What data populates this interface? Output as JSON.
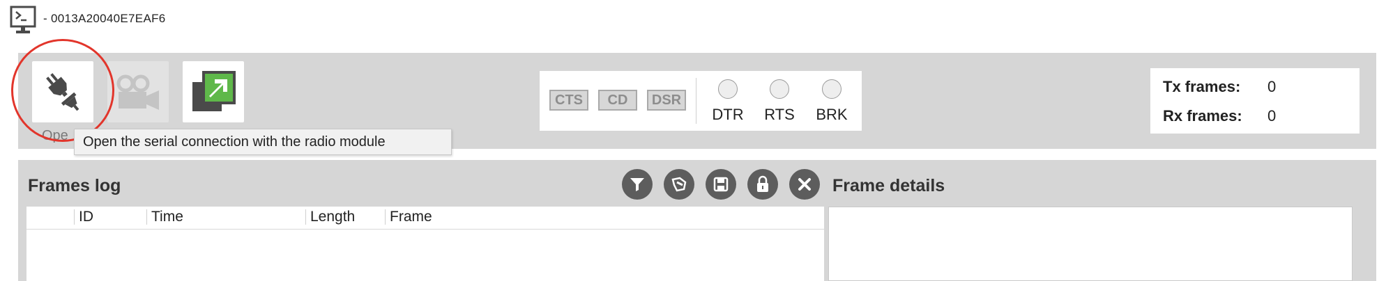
{
  "window": {
    "title": "- 0013A20040E7EAF6",
    "icon": "console-icon"
  },
  "toolbar": {
    "buttons": [
      {
        "name": "open-connection-button",
        "icon": "plug-icon",
        "enabled": true
      },
      {
        "name": "record-button",
        "icon": "video-camera-icon",
        "enabled": false
      },
      {
        "name": "detach-button",
        "icon": "detach-window-icon",
        "enabled": true
      }
    ],
    "open_label_partial": "Ope",
    "tooltip": "Open the serial connection with the radio module"
  },
  "serial_lines": {
    "flags": [
      "CTS",
      "CD",
      "DSR"
    ],
    "leds": [
      "DTR",
      "RTS",
      "BRK"
    ]
  },
  "counters": {
    "tx_label": "Tx frames:",
    "tx_value": "0",
    "rx_label": "Rx frames:",
    "rx_value": "0"
  },
  "frames_log": {
    "title": "Frames log",
    "actions": [
      "filter-icon",
      "clear-log-icon",
      "save-icon",
      "lock-icon",
      "close-icon"
    ],
    "columns": [
      "ID",
      "Time",
      "Length",
      "Frame"
    ]
  },
  "frame_details": {
    "title": "Frame details"
  },
  "colors": {
    "highlight": "#e2352b",
    "toolbar_bg": "#d6d6d6",
    "icon_dark": "#4a4a4a",
    "detach_green": "#5fb84a"
  }
}
